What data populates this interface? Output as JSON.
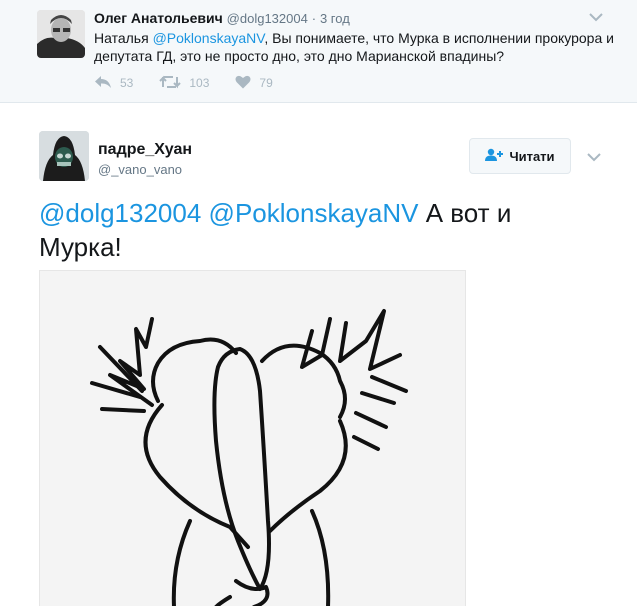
{
  "parent": {
    "name": "Олег Анатольевич",
    "handle": "@dolg132004",
    "separator": "·",
    "time": "3 год",
    "text_before": "Наталья ",
    "mention": "@PoklonskayaNV",
    "text_after": ", Вы понимаете, что Мурка в исполнении прокурора и депутата ГД, это не просто дно, это дно Марианской впадины?",
    "replies": "53",
    "retweets": "103",
    "likes": "79"
  },
  "main": {
    "name": "падре_Хуан",
    "handle": "@_vano_vano",
    "follow_label": "Читати",
    "mention1": "@dolg132004",
    "mention2": "@PoklonskayaNV",
    "text": " А вот и Мурка!"
  },
  "colors": {
    "link": "#1b95e0",
    "muted": "#657786",
    "action_icon": "#aab8c2",
    "parent_bg": "#f5f8fa"
  },
  "icons": [
    "reply-icon",
    "retweet-icon",
    "like-icon",
    "chevron-down-icon",
    "follow-person-icon"
  ]
}
